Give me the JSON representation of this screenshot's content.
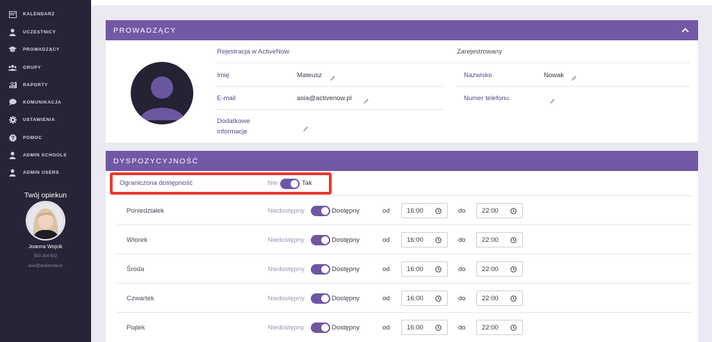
{
  "sidebar": {
    "items": [
      {
        "label": "KALENDARZ",
        "icon": "calendar-icon"
      },
      {
        "label": "UCZESTNICY",
        "icon": "user-icon"
      },
      {
        "label": "PROWADZĄCY",
        "icon": "graduation-cap-icon"
      },
      {
        "label": "GRUPY",
        "icon": "group-icon"
      },
      {
        "label": "RAPORTY",
        "icon": "chart-icon"
      },
      {
        "label": "KOMUNIKACJA",
        "icon": "chat-icon"
      },
      {
        "label": "USTAWIENIA",
        "icon": "gear-icon"
      },
      {
        "label": "POMOC",
        "icon": "help-icon"
      },
      {
        "label": "ADMIN SCHOOLS",
        "icon": "user-icon"
      },
      {
        "label": "ADMIN USERS",
        "icon": "user-icon"
      }
    ],
    "caretaker": {
      "title": "Twój opiekun",
      "name": "Joanna Wojcik",
      "phone": "503 304 502",
      "email": "asia@activenow.io"
    }
  },
  "prowadzacy": {
    "title": "PROWADZĄCY",
    "registration_label": "Rejestracja w ActiveNow",
    "registration_status": "Zarejestrowany",
    "first_name_label": "Imię",
    "first_name": "Mateusz",
    "last_name_label": "Nazwisko",
    "last_name": "Nowak",
    "email_label": "E-mail",
    "email": "asia@activenow.pl",
    "phone_label": "Numer telefonu",
    "phone": "",
    "extra_label_line1": "Dodatkowe",
    "extra_label_line2": "informacje",
    "extra": ""
  },
  "availability": {
    "title": "DYSPOZYCYJNOŚĆ",
    "limited_label": "Ograniczona dostępność",
    "limited_off": "Nie",
    "limited_on": "Tak",
    "limited_value": true,
    "unavailable_label": "Niedostępny",
    "available_label": "Dostępny",
    "from_label": "od",
    "to_label": "do",
    "days": [
      {
        "name": "Poniedziałek",
        "available": true,
        "from": "16:00",
        "to": "22:00"
      },
      {
        "name": "Wtorek",
        "available": true,
        "from": "16:00",
        "to": "22:00"
      },
      {
        "name": "Środa",
        "available": true,
        "from": "16:00",
        "to": "22:00"
      },
      {
        "name": "Czwartek",
        "available": true,
        "from": "16:00",
        "to": "22:00"
      },
      {
        "name": "Piątek",
        "available": true,
        "from": "16:00",
        "to": "22:00"
      }
    ]
  },
  "colors": {
    "sidebar_bg": "#262437",
    "accent": "#7358a6",
    "highlight": "#e8392b"
  }
}
